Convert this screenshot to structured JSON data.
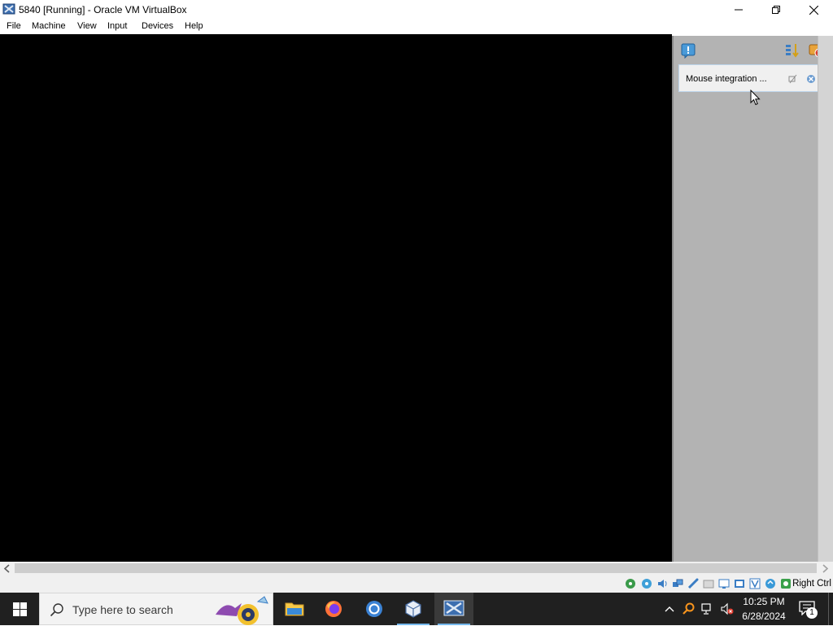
{
  "window": {
    "title": "5840 [Running] - Oracle VM VirtualBox"
  },
  "menu": {
    "items": [
      "File",
      "Machine",
      "View",
      "Input",
      "Devices",
      "Help"
    ]
  },
  "notification_center": {
    "notifications": [
      {
        "text": "Mouse integration ..."
      }
    ]
  },
  "statusbar": {
    "host_key": "Right Ctrl",
    "icons": [
      "hard-disk-icon",
      "optical-drive-icon",
      "audio-icon",
      "network-icon",
      "usb-icon",
      "shared-folders-icon",
      "display-icon",
      "recording-icon",
      "video-capture-icon",
      "virtualization-icon",
      "cpu-icon",
      "mouse-integration-icon"
    ]
  },
  "taskbar": {
    "search_placeholder": "Type here to search",
    "apps": [
      "file-explorer-icon",
      "firefox-icon",
      "chrome-icon",
      "virtualbox-manager-icon",
      "virtualbox-vm-icon"
    ],
    "clock_time": "10:25 PM",
    "clock_date": "6/28/2024",
    "notification_count": "1"
  }
}
